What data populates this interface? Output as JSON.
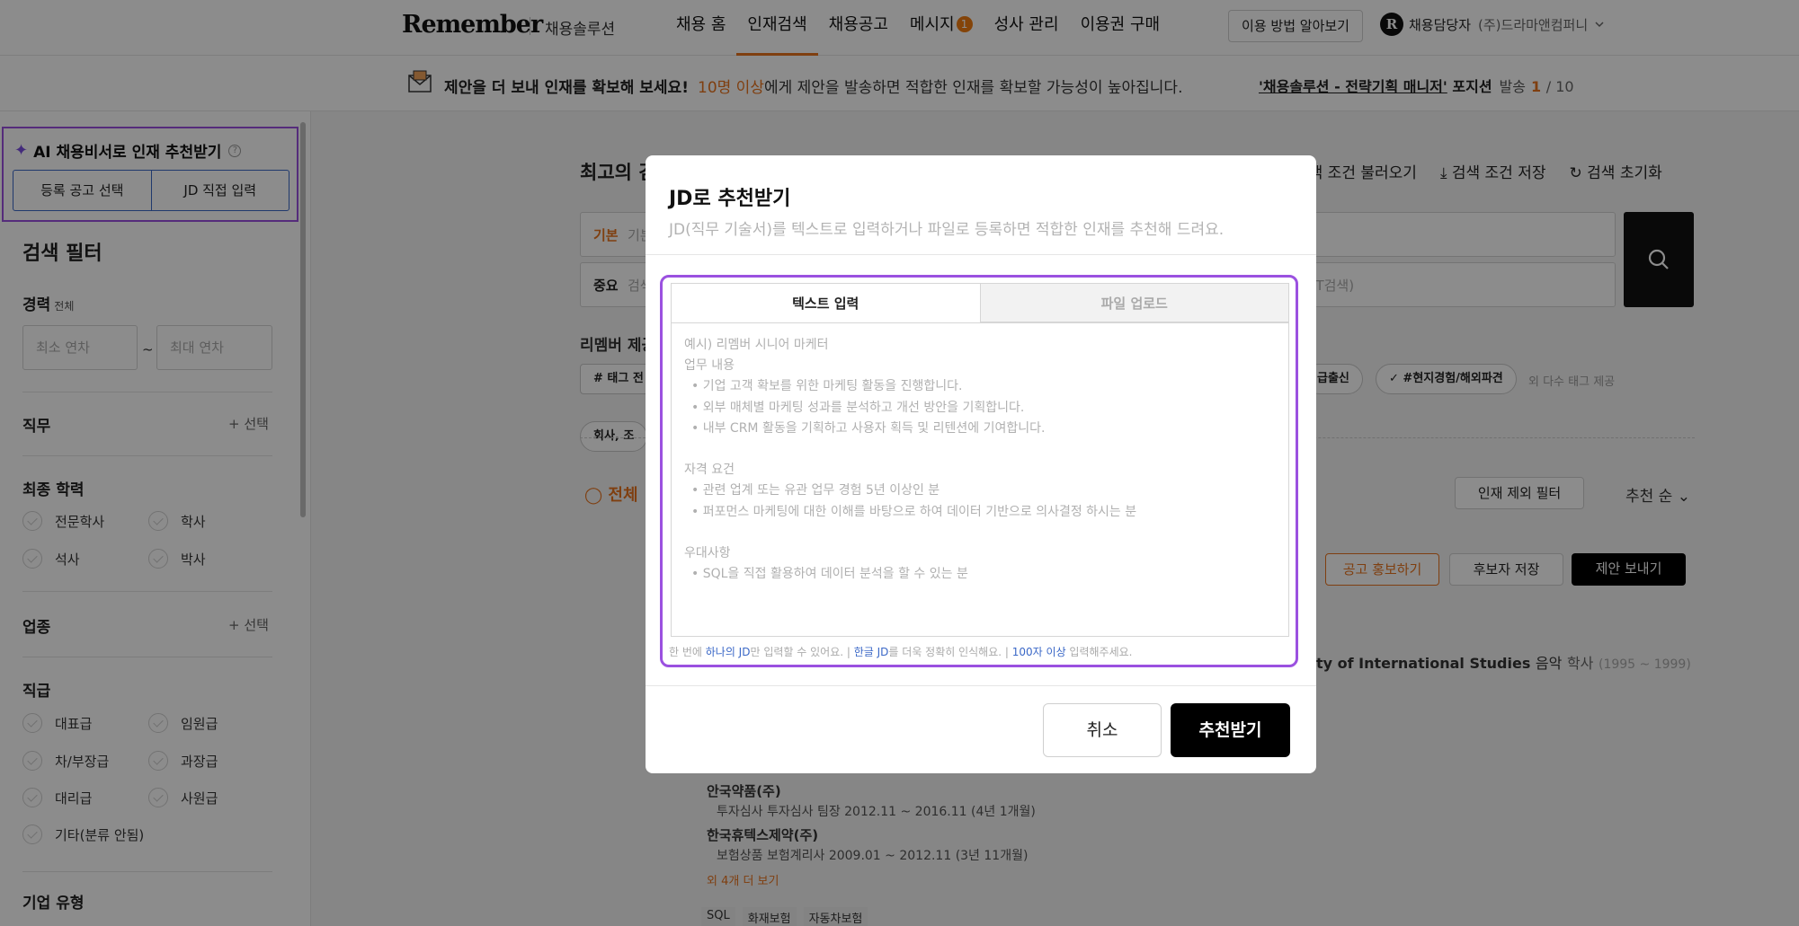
{
  "nav": {
    "logo": "Remember",
    "logo_sub": "채용솔루션",
    "items": [
      {
        "label": "채용 홈"
      },
      {
        "label": "인재검색"
      },
      {
        "label": "채용공고"
      },
      {
        "label": "메시지"
      },
      {
        "label": "성사 관리"
      },
      {
        "label": "이용권 구매"
      }
    ],
    "message_badge": "1",
    "guide_button": "이용 방법 알아보기",
    "user_icon": "R",
    "user_name": "채용담당자",
    "company": "(주)드라마앤컴퍼니"
  },
  "banner": {
    "headline": "제안을 더 보내 인재를 확보해 보세요!",
    "highlight": "10명 이상",
    "message": "에게 제안을 발송하면 적합한 인재를 확보할 가능성이 높아집니다.",
    "position": "'채용솔루션 - 전략기획 매니저'",
    "position_suffix": "포지션",
    "send_label": "발송",
    "sent_count": "1",
    "total": "/ 10"
  },
  "sidebar": {
    "ai_title": "AI 채용비서로 인재 추천받기",
    "ai_tabs": [
      "등록 공고 선택",
      "JD 직접 입력"
    ],
    "filter_title": "검색 필터",
    "career": {
      "label": "경력",
      "sub": "전체",
      "min_placeholder": "최소 연차",
      "max_placeholder": "최대 연차",
      "sep": "~"
    },
    "job": {
      "label": "직무",
      "select": "+ 선택"
    },
    "education": {
      "label": "최종 학력",
      "options": [
        "전문학사",
        "학사",
        "석사",
        "박사"
      ]
    },
    "industry": {
      "label": "업종",
      "select": "+ 선택"
    },
    "rank": {
      "label": "직급",
      "options": [
        "대표급",
        "임원급",
        "차/부장급",
        "과장급",
        "대리급",
        "사원급",
        "기타(분류 안됨)"
      ]
    },
    "company_type": {
      "label": "기업 유형"
    }
  },
  "main": {
    "title": "최고의 검",
    "actions": [
      "검색 조건 불러오기",
      "검색 조건 저장",
      "검색 초기화"
    ],
    "basic_label": "기본",
    "basic_placeholder": "기본",
    "important_label": "중요",
    "important_placeholder": "검색",
    "not_search": "력 (NOT검색)",
    "remember_label": "리멤버 제공",
    "tag_label": "# 태그 전",
    "tag_pills": [
      "급출신",
      "#현지경험/해외파견"
    ],
    "tag_more": "외 다수 태그 제공",
    "company_pill": "회사, 조",
    "all_label": "전체",
    "exclude_filter": "인재 제외 필터",
    "sort": "추천 순",
    "promo_button": "공고 홍보하기",
    "save_candidate": "후보자 저장",
    "send_offer": "제안 보내기",
    "univ": "ty of International Studies",
    "univ_major": "음악",
    "univ_degree": "학사",
    "univ_years": "(1995 ~ 1999)",
    "career_items": [
      {
        "company": "안국약품(주)",
        "detail": "투자심사 투자심사 팀장 2012.11 ~ 2016.11 (4년 1개월)"
      },
      {
        "company": "한국휴텍스제약(주)",
        "detail": "보험상품 보험계리사 2009.01 ~ 2012.11 (3년 11개월)"
      }
    ],
    "more_link": "외 4개 더 보기",
    "skill_tags": [
      "SQL",
      "화재보험",
      "자동차보험"
    ]
  },
  "modal": {
    "title": "JD로 추천받기",
    "description": "JD(직무 기술서)를 텍스트로 입력하거나 파일로 등록하면 적합한 인재를 추천해 드려요.",
    "tabs": [
      "텍스트 입력",
      "파일 업로드"
    ],
    "placeholder_lines": {
      "l1": "예시) 리멤버 시니어 마케터",
      "l2": "업무 내용",
      "l3": "• 기업 고객 확보를 위한 마케팅 활동을 진행합니다.",
      "l4": "• 외부 매체별 마케팅 성과를 분석하고 개선 방안을 기획합니다.",
      "l5": "• 내부 CRM 활동을 기획하고 사용자 획득 및 리텐션에 기여합니다.",
      "l6": "자격 요건",
      "l7": "• 관련 업계 또는 유관 업무 경험 5년 이상인 분",
      "l8": "• 퍼포먼스 마케팅에 대한 이해를 바탕으로 하여 데이터 기반으로 의사결정 하시는 분",
      "l9": "우대사항",
      "l10": "• SQL을 직접 활용하여 데이터 분석을 할 수 있는 분"
    },
    "hint": {
      "p1": "한 번에 ",
      "b1": "하나의 JD",
      "p2": "만 입력할 수 있어요. | ",
      "b2": "한글 JD",
      "p3": "를 더욱 정확히 인식해요. | ",
      "b3": "100자 이상",
      "p4": " 입력해주세요."
    },
    "cancel": "취소",
    "submit": "추천받기"
  },
  "colors": {
    "accent": "#e8731e",
    "highlight_border": "#9b51e0",
    "link": "#3b68c7"
  }
}
